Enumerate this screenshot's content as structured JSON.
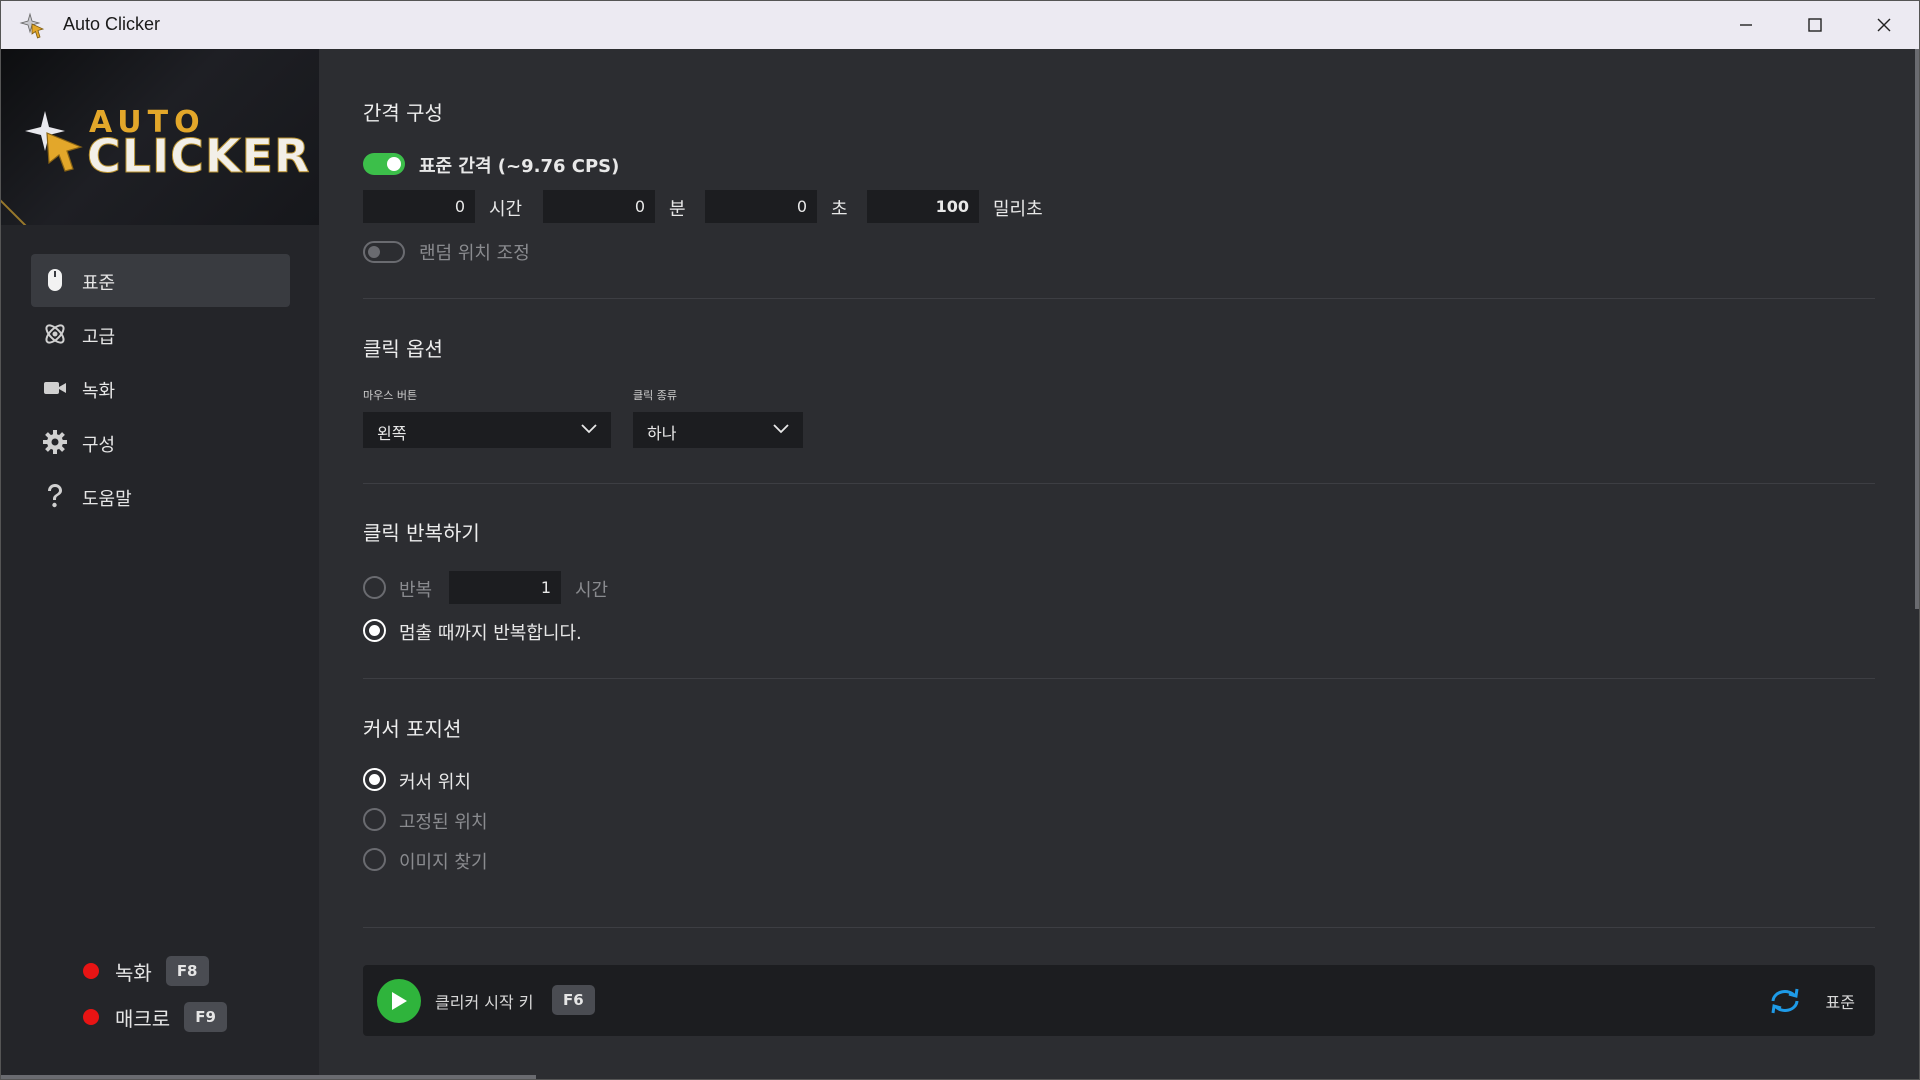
{
  "window": {
    "title": "Auto Clicker"
  },
  "logo": {
    "line1": "AUTO",
    "line2": "CLICKER"
  },
  "sidebar": {
    "items": [
      {
        "label": "표준",
        "icon": "mouse-icon",
        "active": true
      },
      {
        "label": "고급",
        "icon": "atom-icon",
        "active": false
      },
      {
        "label": "녹화",
        "icon": "video-camera-icon",
        "active": false
      },
      {
        "label": "구성",
        "icon": "gear-icon",
        "active": false
      },
      {
        "label": "도움말",
        "icon": "question-icon",
        "active": false
      }
    ],
    "hotkeys": [
      {
        "label": "녹화",
        "key": "F8"
      },
      {
        "label": "매크로",
        "key": "F9"
      }
    ]
  },
  "interval": {
    "title": "간격 구성",
    "standard_label": "표준 간격 (~9.76 CPS)",
    "standard_on": true,
    "hours_value": "0",
    "hours_unit": "시간",
    "minutes_value": "0",
    "minutes_unit": "분",
    "seconds_value": "0",
    "seconds_unit": "초",
    "ms_value": "100",
    "ms_unit": "밀리초",
    "random_label": "랜덤 위치 조정",
    "random_on": false
  },
  "click_options": {
    "title": "클릭 옵션",
    "mouse_button_label": "마우스 버튼",
    "mouse_button_value": "왼쪽",
    "click_type_label": "클릭 종류",
    "click_type_value": "하나"
  },
  "repeat": {
    "title": "클릭 반복하기",
    "repeat_label": "반복",
    "repeat_value": "1",
    "repeat_unit": "시간",
    "until_stopped_label": "멈출 때까지 반복합니다.",
    "selected": "until_stopped"
  },
  "cursor": {
    "title": "커서 포지션",
    "options": [
      {
        "label": "커서 위치",
        "selected": true
      },
      {
        "label": "고정된 위치",
        "selected": false
      },
      {
        "label": "이미지 찾기",
        "selected": false
      }
    ]
  },
  "bottom_bar": {
    "start_label": "클리커 시작 키",
    "start_key": "F6",
    "mode_label": "표준"
  },
  "colors": {
    "accent_green": "#3cbf4a",
    "record_red": "#e81414",
    "logo_gold": "#e3a72a",
    "mode_icon_blue": "#1e9be8"
  }
}
